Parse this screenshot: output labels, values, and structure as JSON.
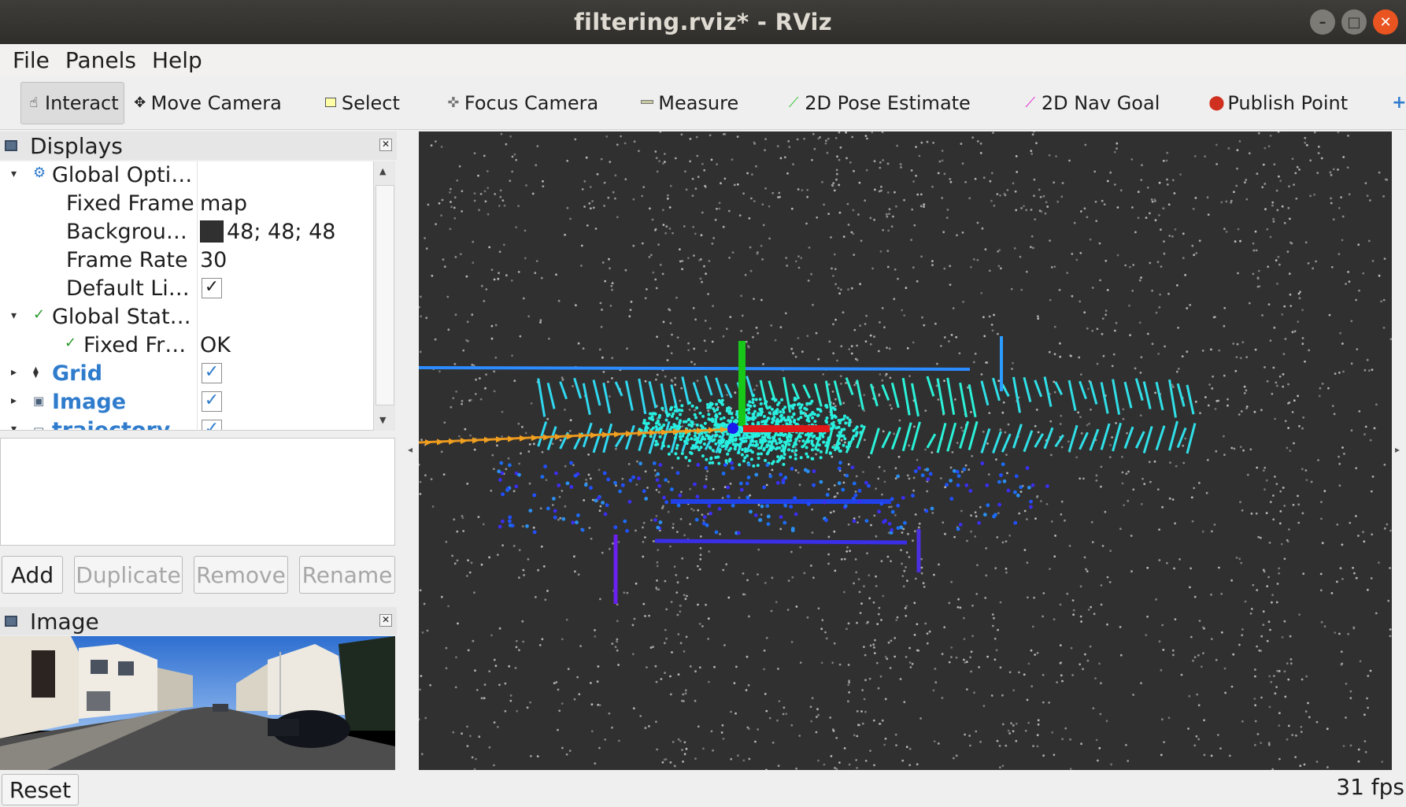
{
  "window": {
    "title": "filtering.rviz* - RViz"
  },
  "menu": {
    "file": "File",
    "panels": "Panels",
    "help": "Help"
  },
  "toolbar": {
    "interact": "Interact",
    "move_camera": "Move Camera",
    "select": "Select",
    "focus_camera": "Focus Camera",
    "measure": "Measure",
    "pose_estimate": "2D Pose Estimate",
    "nav_goal": "2D Nav Goal",
    "publish_point": "Publish Point",
    "add_tool": "+",
    "more": "»"
  },
  "displays_panel": {
    "title": "Displays",
    "rows": {
      "global_options": {
        "label": "Global Opti…"
      },
      "fixed_frame": {
        "label": "Fixed Frame",
        "value": "map"
      },
      "background": {
        "label": "Backgrou…",
        "value": "48; 48; 48",
        "color": "#303030"
      },
      "frame_rate": {
        "label": "Frame Rate",
        "value": "30"
      },
      "default_light": {
        "label": "Default Li…",
        "checked": true
      },
      "global_status": {
        "label": "Global Stat…"
      },
      "fixed_frame_status": {
        "label": "Fixed Fr…",
        "value": "OK"
      },
      "grid": {
        "label": "Grid",
        "checked": true
      },
      "image": {
        "label": "Image",
        "checked": true
      },
      "trajectory": {
        "label": "trajectory",
        "checked": true
      }
    },
    "buttons": {
      "add": "Add",
      "duplicate": "Duplicate",
      "remove": "Remove",
      "rename": "Rename"
    }
  },
  "image_panel": {
    "title": "Image"
  },
  "status": {
    "reset": "Reset",
    "fps": "31 fps"
  },
  "colors": {
    "viewport_bg": "#303030",
    "accent_blue": "#2f7ccd",
    "close_button": "#e95420"
  }
}
